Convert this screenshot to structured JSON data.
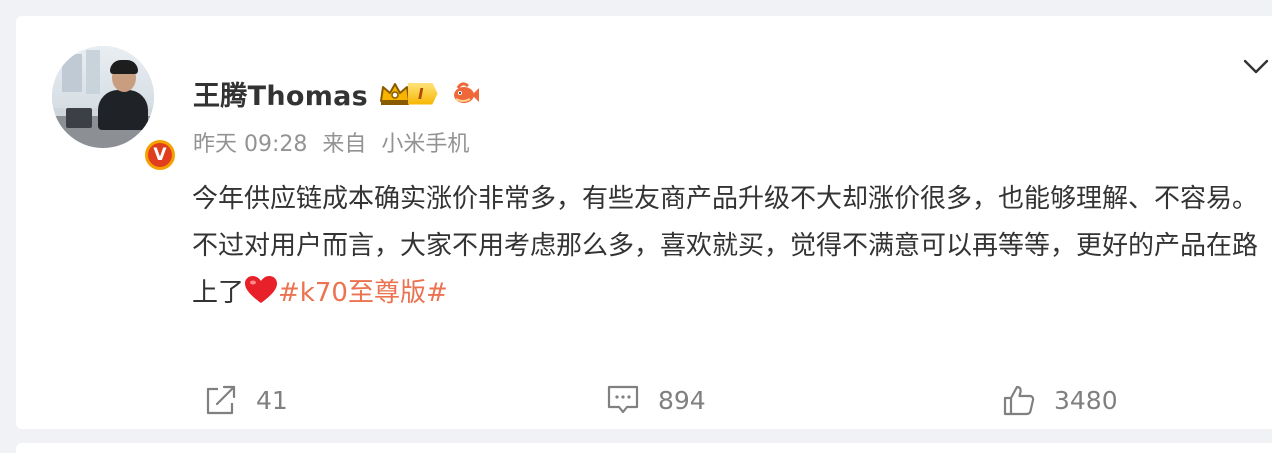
{
  "user": {
    "name": "王腾Thomas",
    "level": "I",
    "verified_mark": "V"
  },
  "meta": {
    "time": "昨天 09:28",
    "source_prefix": "来自",
    "source": "小米手机"
  },
  "post": {
    "line1": "今年供应链成本确实涨价非常多，有些友商产品升级不大却涨价很多，也能够理解、不容易。",
    "line2": "不过对用户而言，大家不用考虑那么多，喜欢就买，觉得不满意可以再等等，更好的产品在路上了",
    "hashtag": "#k70至尊版#"
  },
  "actions": {
    "repost_count": "41",
    "comment_count": "894",
    "like_count": "3480"
  },
  "colors": {
    "hashtag": "#eb7350",
    "heart": "#e8202a",
    "meta": "#939393",
    "text": "#333333"
  },
  "icons": [
    "share-icon",
    "comment-icon",
    "like-icon",
    "chevron-down-icon",
    "crown-icon",
    "fish-icon",
    "heart-emoji-icon",
    "verified-badge-icon"
  ]
}
